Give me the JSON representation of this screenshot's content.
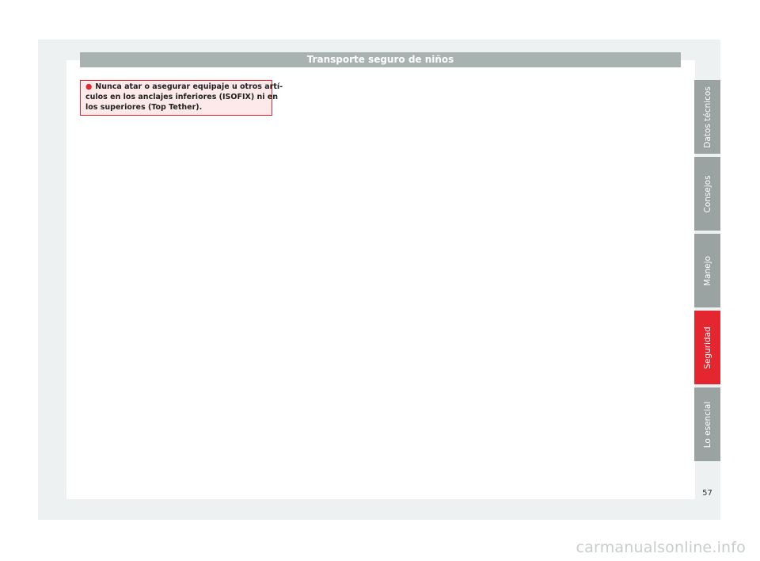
{
  "header": {
    "title": "Transporte seguro de niños"
  },
  "warning": {
    "bullet_icon": "red-bullet-icon",
    "lines": [
      "Nunca atar o asegurar equipaje u otros artí-",
      "culos en los anclajes inferiores (ISOFIX) ni en",
      "los superiores (Top Tether)."
    ]
  },
  "side_tabs": [
    {
      "label": "Datos técnicos",
      "active": false
    },
    {
      "label": "Consejos",
      "active": false
    },
    {
      "label": "Manejo",
      "active": false
    },
    {
      "label": "Seguridad",
      "active": true
    },
    {
      "label": "Lo esencial",
      "active": false
    }
  ],
  "page_number": "57",
  "watermark": "carmanualsonline.info",
  "colors": {
    "accent": "#e3262f",
    "header_bar": "#a8b3b1",
    "tab_inactive": "#9aa3a1",
    "warning_background": "#fde8ea"
  }
}
